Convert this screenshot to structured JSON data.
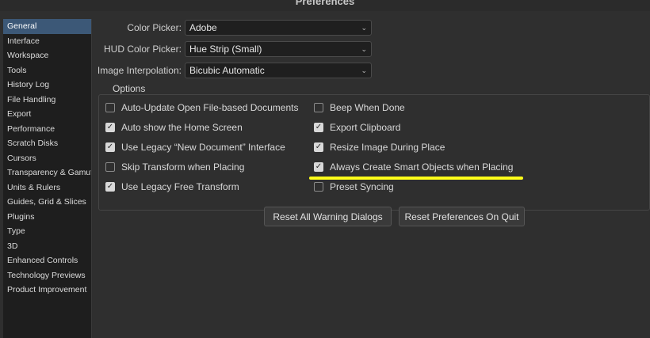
{
  "window": {
    "title": "Preferences"
  },
  "sidebar": {
    "items": [
      {
        "label": "General",
        "selected": true
      },
      {
        "label": "Interface"
      },
      {
        "label": "Workspace"
      },
      {
        "label": "Tools"
      },
      {
        "label": "History Log"
      },
      {
        "label": "File Handling"
      },
      {
        "label": "Export"
      },
      {
        "label": "Performance"
      },
      {
        "label": "Scratch Disks"
      },
      {
        "label": "Cursors"
      },
      {
        "label": "Transparency & Gamut"
      },
      {
        "label": "Units & Rulers"
      },
      {
        "label": "Guides, Grid & Slices"
      },
      {
        "label": "Plugins"
      },
      {
        "label": "Type"
      },
      {
        "label": "3D"
      },
      {
        "label": "Enhanced Controls"
      },
      {
        "label": "Technology Previews"
      },
      {
        "label": "Product Improvement"
      }
    ]
  },
  "pickers": {
    "color_picker": {
      "label": "Color Picker:",
      "value": "Adobe"
    },
    "hud_color_picker": {
      "label": "HUD Color Picker:",
      "value": "Hue Strip (Small)"
    },
    "image_interpolation": {
      "label": "Image Interpolation:",
      "value": "Bicubic Automatic"
    }
  },
  "options": {
    "title": "Options",
    "left": [
      {
        "label": "Auto-Update Open File-based Documents",
        "checked": false
      },
      {
        "label": "Auto show the Home Screen",
        "checked": true
      },
      {
        "label": "Use Legacy “New Document” Interface",
        "checked": true
      },
      {
        "label": "Skip Transform when Placing",
        "checked": false
      },
      {
        "label": "Use Legacy Free Transform",
        "checked": true
      }
    ],
    "right": [
      {
        "label": "Beep When Done",
        "checked": false
      },
      {
        "label": "Export Clipboard",
        "checked": true
      },
      {
        "label": "Resize Image During Place",
        "checked": true
      },
      {
        "label": "Always Create Smart Objects when Placing",
        "checked": true
      },
      {
        "label": "Preset Syncing",
        "checked": false
      }
    ]
  },
  "buttons": {
    "reset_warnings": "Reset All Warning Dialogs",
    "reset_prefs": "Reset Preferences On Quit"
  },
  "icons": {
    "chevron": "chevron-down-icon",
    "check": "✓"
  },
  "colors": {
    "highlight": "#ffff19",
    "selected": "#3c5877"
  }
}
